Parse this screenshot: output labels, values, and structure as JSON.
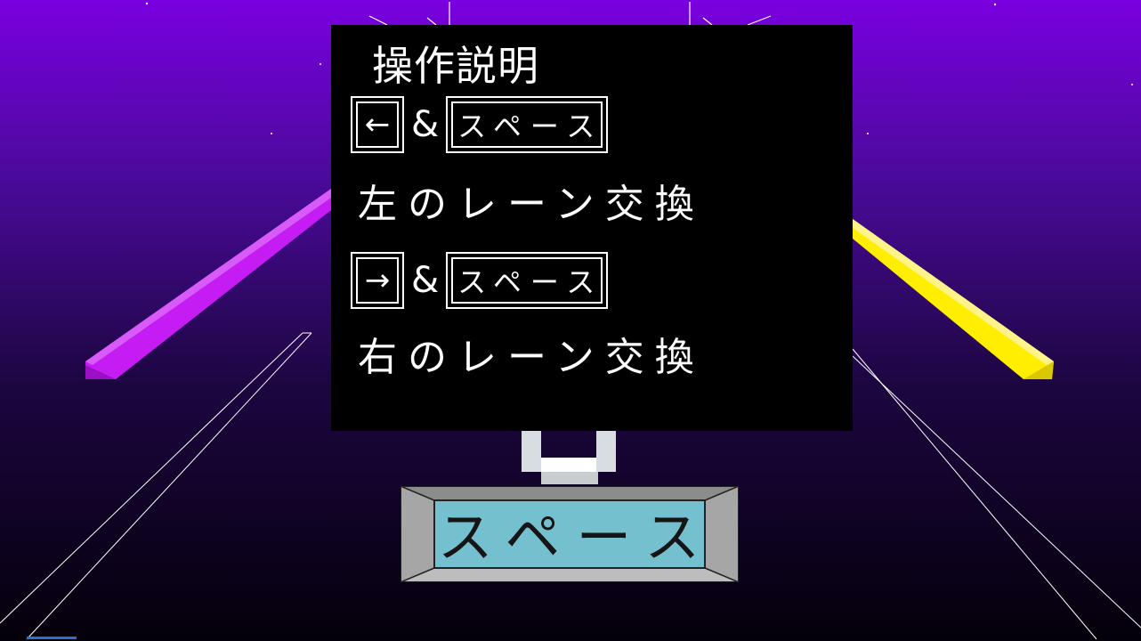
{
  "colors": {
    "background_top": "#7a00e0",
    "background_bottom": "#04000a",
    "left_rail": "#c41cf2",
    "right_rail": "#ffee00",
    "panel": "#000000",
    "panel_text": "#ffffff",
    "space_key_face": "#74c0cf",
    "space_key_bezel": "#a6a6a6",
    "u_icon": "#d8dde2"
  },
  "panel": {
    "title": "操作説明",
    "rows": [
      {
        "arrow_key": "←",
        "arrow_icon": "left-arrow-icon",
        "connector": "&",
        "space_key": "スペース",
        "description": "左のレーン交換"
      },
      {
        "arrow_key": "→",
        "arrow_icon": "right-arrow-icon",
        "connector": "&",
        "space_key": "スペース",
        "description": "右のレーン交換"
      }
    ]
  },
  "space_button": {
    "label": "スペース"
  },
  "press_indicator": {
    "icon": "u-shape-press-icon"
  }
}
